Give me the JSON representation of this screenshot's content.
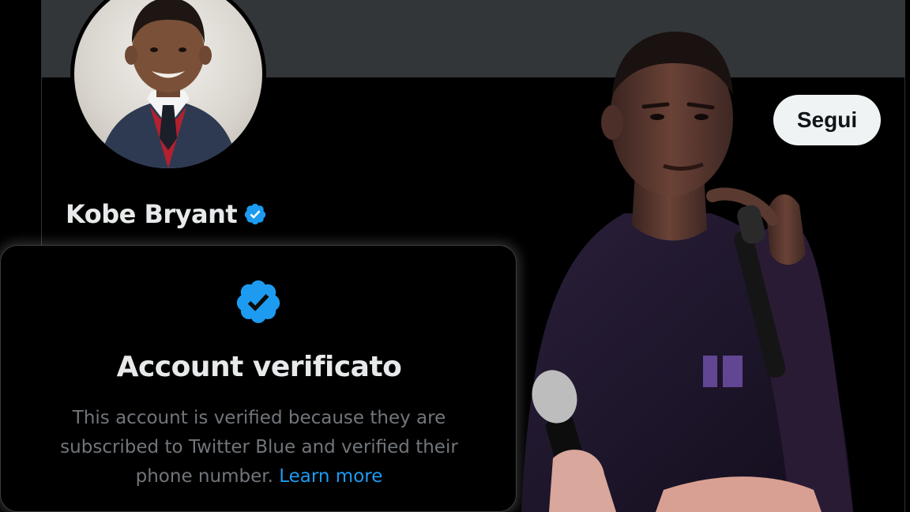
{
  "profile": {
    "display_name": "Kobe Bryant",
    "follow_label": "Segui",
    "verified_badge_icon": "verified-badge-icon"
  },
  "popover": {
    "title": "Account verificato",
    "body_prefix": "This account is verified because they are subscribed to Twitter Blue and verified their phone number.",
    "learn_more": "Learn more",
    "badge_icon": "verified-badge-icon"
  },
  "colors": {
    "background": "#000000",
    "banner": "#333639",
    "text_primary": "#e7e9ea",
    "text_secondary": "#71767b",
    "accent_blue": "#1d9bf0",
    "follow_button_bg": "#eff3f4"
  }
}
